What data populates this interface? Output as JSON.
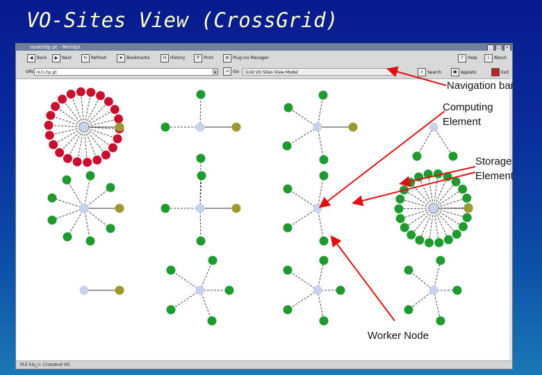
{
  "slide": {
    "title": "VO-Sites View (CrossGrid)"
  },
  "window": {
    "title": "nodelidp.pt - MiniXpl",
    "statusbar": "PLE hlq_n:  CrossAnd VO"
  },
  "toolbar": {
    "buttons": [
      {
        "label": "Back",
        "icon": "back-icon"
      },
      {
        "label": "Next",
        "icon": "next-icon"
      },
      {
        "label": "Refresh",
        "icon": "refresh-icon"
      },
      {
        "label": "Bookmarks",
        "icon": "bookmarks-icon"
      },
      {
        "label": "History",
        "icon": "history-icon"
      },
      {
        "label": "Print",
        "icon": "print-icon"
      },
      {
        "label": "Plug-ins Manager",
        "icon": "plugins-icon"
      },
      {
        "label": "Help",
        "icon": "help-icon"
      },
      {
        "label": "About",
        "icon": "about-icon"
      }
    ]
  },
  "urlbar": {
    "url_label": "URL",
    "url_value": "nU1.hp.pt",
    "go_label": "Go",
    "location": "Grid VO Sites View Model",
    "search_label": "Search",
    "applet_label": "Applets",
    "exit_label": "Exit"
  },
  "annotations": {
    "navigation_bar": "Navigation bar",
    "computing_element_1": "Computing",
    "computing_element_2": "Element",
    "storage_element_1": "Storage",
    "storage_element_2": "Element",
    "worker_node": "Worker Node"
  },
  "colors": {
    "computing_element": "#c8d2ee",
    "storage_element": "#9a9a2e",
    "worker_node_green": "#1e9a2e",
    "worker_node_red": "#c8102e",
    "arrow": "#e01010"
  }
}
